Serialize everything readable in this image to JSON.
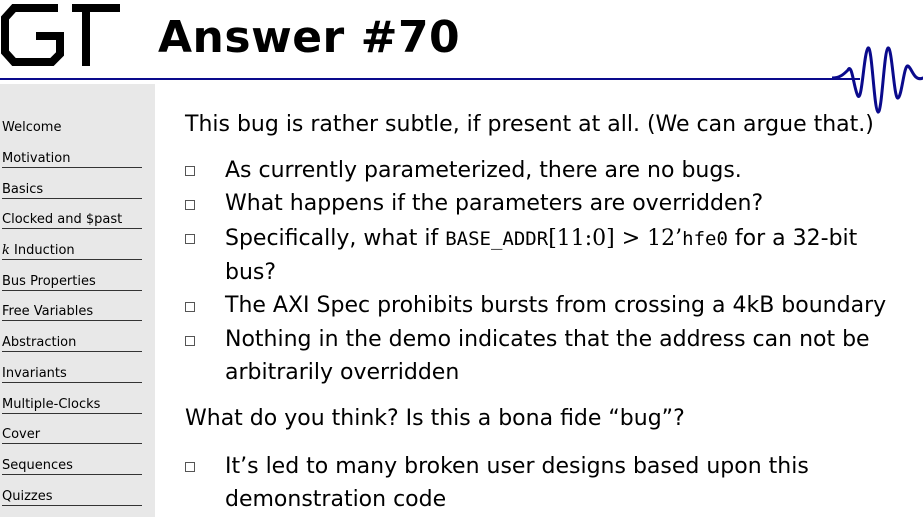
{
  "header": {
    "title": "Answer #70",
    "logo_text": "GT"
  },
  "sidebar": {
    "items": [
      {
        "label": "Welcome"
      },
      {
        "label": "Motivation"
      },
      {
        "label": "Basics"
      },
      {
        "label": "Clocked and $past"
      },
      {
        "label_var": "k",
        "label": " Induction"
      },
      {
        "label": "Bus Properties"
      },
      {
        "label": "Free Variables"
      },
      {
        "label": "Abstraction"
      },
      {
        "label": "Invariants"
      },
      {
        "label": "Multiple-Clocks"
      },
      {
        "label": "Cover"
      },
      {
        "label": "Sequences"
      },
      {
        "label": "Quizzes"
      }
    ]
  },
  "content": {
    "intro": "This bug is rather subtle, if present at all. (We can argue that.)",
    "bullets1": [
      "As currently parameterized, there are no bugs.",
      "What happens if the parameters are overridden?",
      {
        "pre": "Specifically, what if ",
        "code1": "BASE_ADDR",
        "mid": "[11:0] > 12’",
        "code2": "hfe0",
        "post": " for a 32-bit",
        "line2": "bus?"
      },
      "The AXI Spec prohibits bursts from crossing a 4kB boundary",
      {
        "line1": "Nothing in the demo indicates that the address can not be",
        "line2": "arbitrarily overridden"
      }
    ],
    "question": "What do you think? Is this a bona fide “bug”?",
    "bullets2": [
      {
        "line1": "It’s led to many broken user designs based upon this",
        "line2": "demonstration code"
      }
    ]
  },
  "colors": {
    "header_line": "#0a0a8c",
    "wave": "#0a0a8c",
    "sidebar_bg": "#e8e8e8"
  }
}
